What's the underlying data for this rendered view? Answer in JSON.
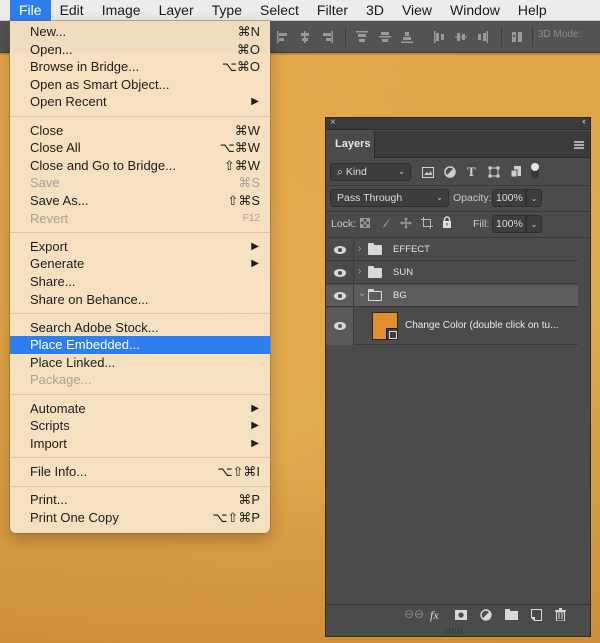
{
  "menubar": {
    "items": [
      "File",
      "Edit",
      "Image",
      "Layer",
      "Type",
      "Select",
      "Filter",
      "3D",
      "View",
      "Window",
      "Help"
    ],
    "active": "File"
  },
  "options_bar": {
    "mode_label": "3D Mode:"
  },
  "file_menu": {
    "groups": [
      [
        {
          "label": "New...",
          "shortcut": "⌘N"
        },
        {
          "label": "Open...",
          "shortcut": "⌘O"
        },
        {
          "label": "Browse in Bridge...",
          "shortcut": "⌥⌘O"
        },
        {
          "label": "Open as Smart Object...",
          "shortcut": ""
        },
        {
          "label": "Open Recent",
          "submenu": true
        }
      ],
      [
        {
          "label": "Close",
          "shortcut": "⌘W"
        },
        {
          "label": "Close All",
          "shortcut": "⌥⌘W"
        },
        {
          "label": "Close and Go to Bridge...",
          "shortcut": "⇧⌘W"
        },
        {
          "label": "Save",
          "shortcut": "⌘S",
          "disabled": true
        },
        {
          "label": "Save As...",
          "shortcut": "⇧⌘S"
        },
        {
          "label": "Revert",
          "shortcut": "F12",
          "disabled": true
        }
      ],
      [
        {
          "label": "Export",
          "submenu": true
        },
        {
          "label": "Generate",
          "submenu": true
        },
        {
          "label": "Share...",
          "shortcut": ""
        },
        {
          "label": "Share on Behance...",
          "shortcut": ""
        }
      ],
      [
        {
          "label": "Search Adobe Stock...",
          "shortcut": ""
        },
        {
          "label": "Place Embedded...",
          "shortcut": "",
          "highlighted": true
        },
        {
          "label": "Place Linked...",
          "shortcut": ""
        },
        {
          "label": "Package...",
          "shortcut": "",
          "disabled": true
        }
      ],
      [
        {
          "label": "Automate",
          "submenu": true
        },
        {
          "label": "Scripts",
          "submenu": true
        },
        {
          "label": "Import",
          "submenu": true
        }
      ],
      [
        {
          "label": "File Info...",
          "shortcut": "⌥⇧⌘I"
        }
      ],
      [
        {
          "label": "Print...",
          "shortcut": "⌘P"
        },
        {
          "label": "Print One Copy",
          "shortcut": "⌥⇧⌘P"
        }
      ]
    ]
  },
  "layers_panel": {
    "tab_label": "Layers",
    "filter_kind": "Kind",
    "blend_mode": "Pass Through",
    "opacity_label": "Opacity:",
    "opacity_value": "100%",
    "lock_label": "Lock:",
    "fill_label": "Fill:",
    "fill_value": "100%",
    "layers": [
      {
        "name": "EFFECT",
        "type": "group",
        "expanded": false,
        "visible": true
      },
      {
        "name": "SUN",
        "type": "group",
        "expanded": false,
        "visible": true
      },
      {
        "name": "BG",
        "type": "group",
        "expanded": true,
        "visible": true,
        "selected": true
      },
      {
        "name": "Change Color (double click on tu...",
        "type": "fill-layer",
        "visible": true,
        "thumbnail_color": "#E08E2F"
      }
    ]
  },
  "colors": {
    "menu_highlight": "#2F7EF0",
    "panel_bg": "#4B4B4B",
    "canvas": "#E0A545"
  }
}
